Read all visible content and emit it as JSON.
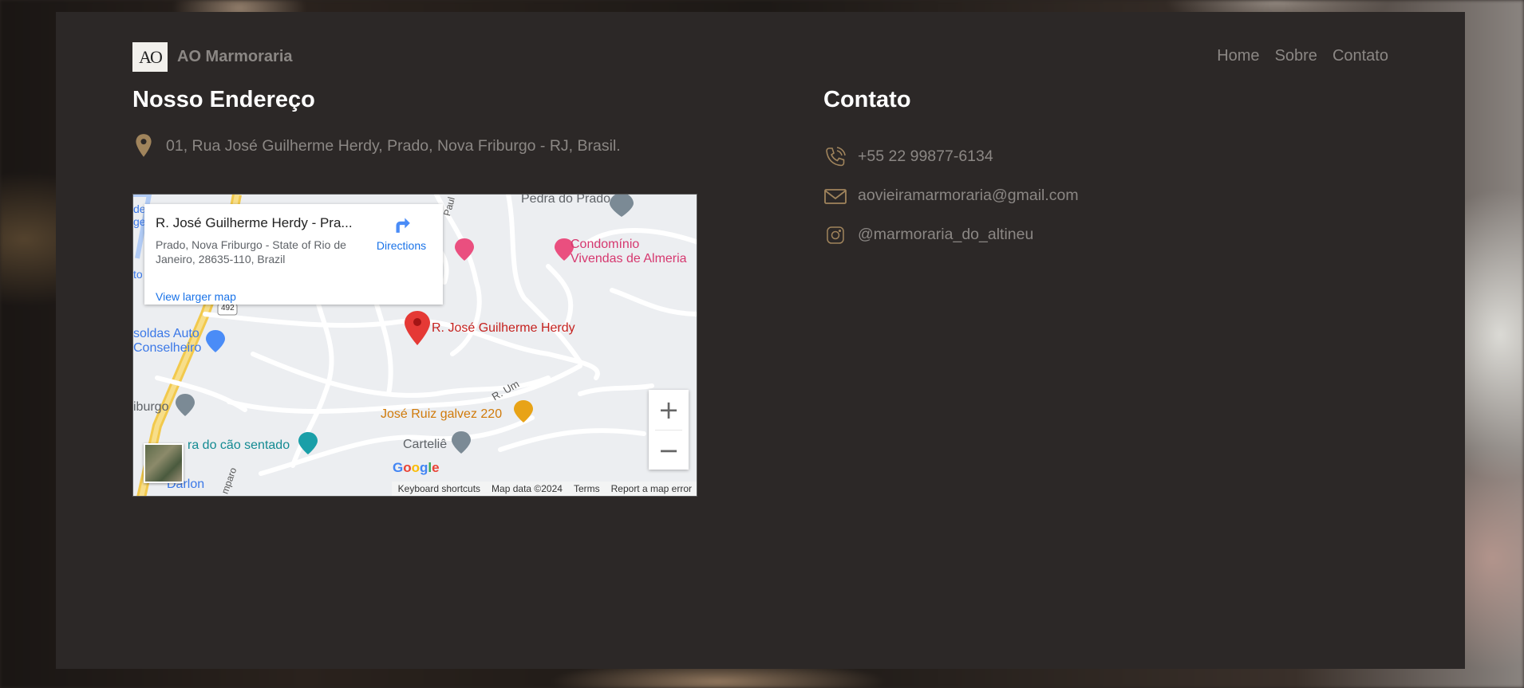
{
  "brand": {
    "logo_text": "AO",
    "name": "AO Marmoraria"
  },
  "nav": {
    "items": [
      "Home",
      "Sobre",
      "Contato"
    ]
  },
  "address_section": {
    "title": "Nosso Endereço",
    "address": "01, Rua José Guilherme Herdy, Prado, Nova Friburgo - RJ, Brasil.",
    "icon": "map-pin-icon",
    "icon_color": "#a0845c"
  },
  "contact_section": {
    "title": "Contato",
    "phone": "+55 22 99877-6134",
    "email": "aovieiramarmoraria@gmail.com",
    "instagram": "@marmoraria_do_altineu",
    "icon_color": "#a0845c"
  },
  "map": {
    "place_title": "R. José Guilherme Herdy - Pra...",
    "place_address": "Prado, Nova Friburgo - State of Rio de Janeiro, 28635-110, Brazil",
    "directions_label": "Directions",
    "view_larger_label": "View larger map",
    "marker_label": "R. José Guilherme Herdy",
    "labels": {
      "pedra": "Pedra do Prado",
      "condominio_1": "Condomínio",
      "condominio_2": "Vivendas de Almeria",
      "soldas_1": "soldas Auto",
      "soldas_2": "Conselheiro",
      "friburgo": "iburgo",
      "jose_ruiz": "José Ruiz galvez 220",
      "cao": "ra do cão sentado",
      "cartelie": "Carteliê",
      "darlon": "Darlon",
      "r_um": "R. Um",
      "route": "492",
      "paul": "Paul",
      "amparo": "mparo",
      "de": "de",
      "ge": "ge",
      "to": "to"
    },
    "zoom_in": "+",
    "zoom_out": "−",
    "google": "Google",
    "attribution": [
      "Keyboard shortcuts",
      "Map data ©2024",
      "Terms",
      "Report a map error"
    ]
  }
}
